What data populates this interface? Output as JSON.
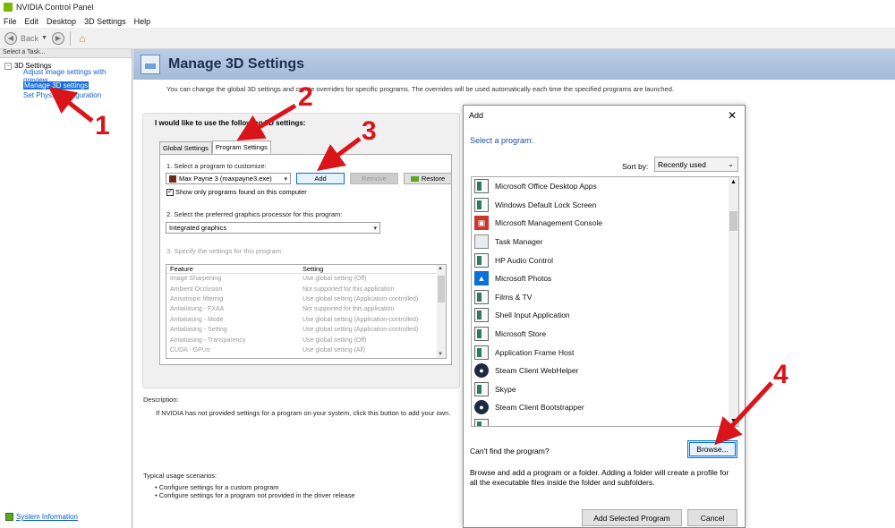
{
  "window": {
    "title": "NVIDIA Control Panel"
  },
  "menu": [
    "File",
    "Edit",
    "Desktop",
    "3D Settings",
    "Help"
  ],
  "toolbar": {
    "back_label": "Back"
  },
  "sidebar": {
    "header": "Select a Task...",
    "root": "3D Settings",
    "items": [
      {
        "label": "Adjust image settings with preview"
      },
      {
        "label": "Manage 3D settings"
      },
      {
        "label": "Set PhysX Configuration"
      }
    ],
    "system_info": "System Information"
  },
  "page": {
    "title": "Manage 3D Settings",
    "intro": "You can change the global 3D settings and create overrides for specific programs. The overrides will be used automatically each time the specified programs are launched.",
    "heading": "I would like to use the following 3D settings:",
    "tabs": [
      "Global Settings",
      "Program Settings"
    ],
    "step1": "1. Select a program to customize:",
    "program_value": "Max Payne 3 (maxpayne3.exe)",
    "add_label": "Add",
    "remove_label": "Remove",
    "restore_label": "Restore",
    "checkbox_label": "Show only programs found on this computer",
    "step2": "2. Select the preferred graphics processor for this program:",
    "gpu_value": "Integrated graphics",
    "step3": "3. Specify the settings for this program:",
    "table_headers": [
      "Feature",
      "Setting"
    ],
    "table_rows": [
      [
        "Image Sharpening",
        "Use global setting (Off)"
      ],
      [
        "Ambient Occlusion",
        "Not supported for this application"
      ],
      [
        "Anisotropic filtering",
        "Use global setting (Application-controlled)"
      ],
      [
        "Antialiasing - FXAA",
        "Not supported for this application"
      ],
      [
        "Antialiasing - Mode",
        "Use global setting (Application-controlled)"
      ],
      [
        "Antialiasing - Setting",
        "Use global setting (Application-controlled)"
      ],
      [
        "Antialiasing - Transparency",
        "Use global setting (Off)"
      ],
      [
        "CUDA - GPUs",
        "Use global setting (All)"
      ]
    ],
    "description_label": "Description:",
    "description_text": "If NVIDIA has not provided settings for a program on your system, click this button to add your own.",
    "usage_label": "Typical usage scenarios:",
    "usage_items": [
      "Configure settings for a custom program",
      "Configure settings for a program not provided in the driver release"
    ]
  },
  "dialog": {
    "title": "Add",
    "select_label": "Select a program:",
    "sort_label": "Sort by:",
    "sort_value": "Recently used",
    "programs": [
      {
        "name": "Microsoft Office Desktop Apps",
        "icon": "generic-app-icon"
      },
      {
        "name": "Windows Default Lock Screen",
        "icon": "generic-app-icon"
      },
      {
        "name": "Microsoft Management Console",
        "icon": "mmc-icon"
      },
      {
        "name": "Task Manager",
        "icon": "task-manager-icon"
      },
      {
        "name": "HP Audio Control",
        "icon": "generic-app-icon"
      },
      {
        "name": "Microsoft Photos",
        "icon": "photos-icon"
      },
      {
        "name": "Films & TV",
        "icon": "generic-app-icon"
      },
      {
        "name": "Shell Input Application",
        "icon": "generic-app-icon"
      },
      {
        "name": "Microsoft Store",
        "icon": "generic-app-icon"
      },
      {
        "name": "Application Frame Host",
        "icon": "generic-app-icon"
      },
      {
        "name": "Steam Client WebHelper",
        "icon": "steam-icon"
      },
      {
        "name": "Skype",
        "icon": "generic-app-icon"
      },
      {
        "name": "Steam Client Bootstrapper",
        "icon": "steam-icon"
      }
    ],
    "cant_find": "Can't find the program?",
    "browse_label": "Browse...",
    "browse_desc": "Browse and add a program or a folder. Adding a folder will create a profile for all the executable files inside the folder and subfolders.",
    "add_selected_label": "Add Selected Program",
    "cancel_label": "Cancel"
  },
  "annotations": [
    "1",
    "2",
    "3",
    "4"
  ],
  "colors": {
    "accent": "#1a6fd9",
    "annotation_red": "#d9151b",
    "nvidia_green": "#76b900"
  }
}
